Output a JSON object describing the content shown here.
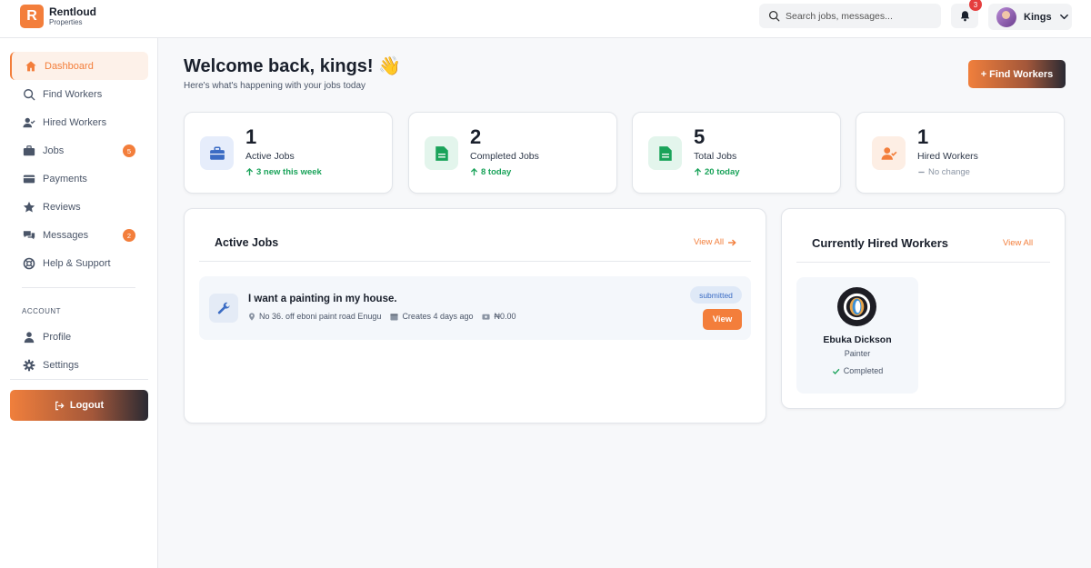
{
  "brand": {
    "name": "Rentloud",
    "sub": "Properties",
    "letter": "R"
  },
  "header": {
    "search_placeholder": "Search jobs, messages...",
    "notifications_count": "3",
    "user_name": "Kings"
  },
  "sidebar": {
    "items": [
      {
        "label": "Dashboard"
      },
      {
        "label": "Find Workers"
      },
      {
        "label": "Hired Workers"
      },
      {
        "label": "Jobs",
        "badge": "5"
      },
      {
        "label": "Payments"
      },
      {
        "label": "Reviews"
      },
      {
        "label": "Messages",
        "badge": "2"
      },
      {
        "label": "Help & Support"
      }
    ],
    "account_label": "ACCOUNT",
    "account_items": [
      {
        "label": "Profile"
      },
      {
        "label": "Settings"
      }
    ],
    "logout_label": "Logout"
  },
  "main": {
    "title": "Welcome back, kings! 👋",
    "subtitle": "Here's what's happening with your jobs today",
    "find_workers_label": "+ Find Workers",
    "stats": [
      {
        "value": "1",
        "label": "Active Jobs",
        "trend": "3 new this week"
      },
      {
        "value": "2",
        "label": "Completed Jobs",
        "trend": "8 today"
      },
      {
        "value": "5",
        "label": "Total Jobs",
        "trend": "20 today"
      },
      {
        "value": "1",
        "label": "Hired Workers",
        "trend": "No change"
      }
    ],
    "active_jobs": {
      "title": "Active Jobs",
      "view_all": "View All",
      "jobs": [
        {
          "title": "I want a painting in my house.",
          "location": "No 36. off eboni paint road Enugu",
          "created": "Creates 4 days ago",
          "amount": "₦0.00",
          "status": "submitted",
          "action": "View"
        }
      ]
    },
    "hired_workers": {
      "title": "Currently Hired Workers",
      "view_all": "View All",
      "workers": [
        {
          "name": "Ebuka Dickson",
          "role": "Painter",
          "status": "Completed"
        }
      ]
    }
  },
  "colors": {
    "accent": "#f37e3b",
    "success": "#1aa35a",
    "pill_text": "#3b6cc4"
  }
}
